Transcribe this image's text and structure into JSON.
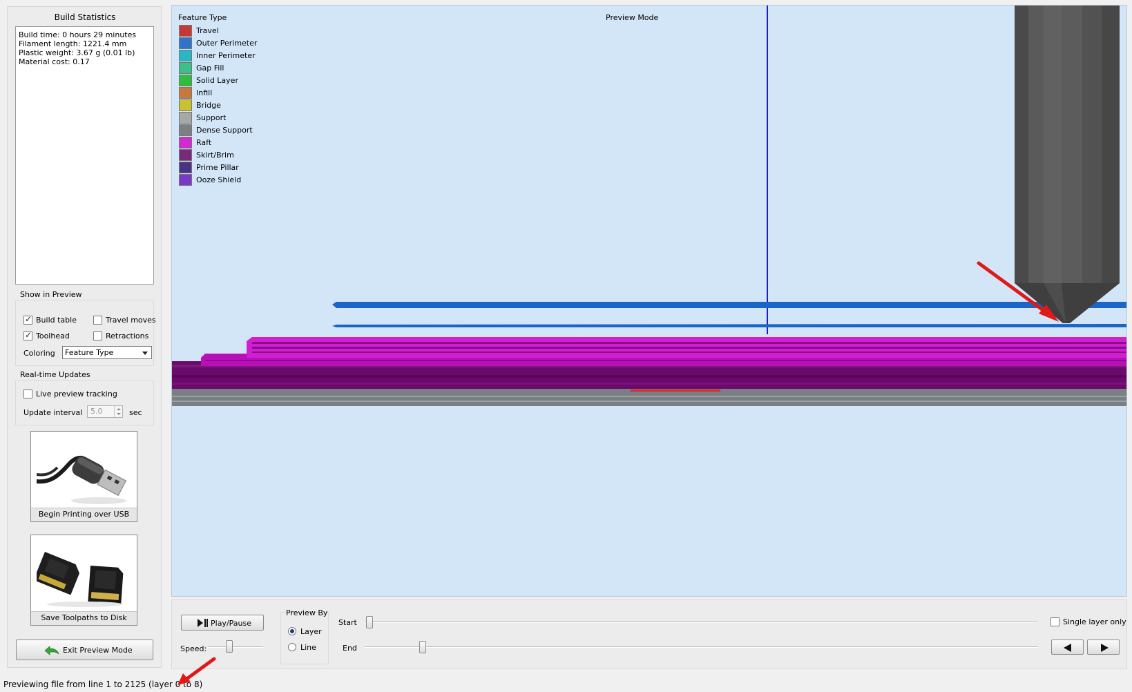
{
  "build_statistics": {
    "title": "Build Statistics",
    "lines": [
      "Build time: 0 hours 29 minutes",
      "Filament length: 1221.4 mm",
      "Plastic weight: 3.67 g (0.01 lb)",
      "Material cost: 0.17"
    ]
  },
  "show_in_preview": {
    "title": "Show in Preview",
    "build_table": {
      "label": "Build table",
      "checked": true
    },
    "travel_moves": {
      "label": "Travel moves",
      "checked": false
    },
    "toolhead": {
      "label": "Toolhead",
      "checked": true
    },
    "retractions": {
      "label": "Retractions",
      "checked": false
    },
    "coloring_label": "Coloring",
    "coloring_value": "Feature Type"
  },
  "realtime_updates": {
    "title": "Real-time Updates",
    "live_preview": {
      "label": "Live preview tracking",
      "checked": false
    },
    "interval_label": "Update interval",
    "interval_value": "5.0",
    "interval_unit": "sec"
  },
  "actions": {
    "usb_label": "Begin Printing over USB",
    "save_label": "Save Toolpaths to Disk",
    "exit_label": "Exit Preview Mode"
  },
  "viewport": {
    "legend_title": "Feature Type",
    "mode_label": "Preview Mode",
    "legend": [
      {
        "label": "Travel",
        "color": "#c83737"
      },
      {
        "label": "Outer Perimeter",
        "color": "#2f74c9"
      },
      {
        "label": "Inner Perimeter",
        "color": "#26b8c4"
      },
      {
        "label": "Gap Fill",
        "color": "#3cc08a"
      },
      {
        "label": "Solid Layer",
        "color": "#2fbd3c"
      },
      {
        "label": "Infill",
        "color": "#c8783a"
      },
      {
        "label": "Bridge",
        "color": "#c8c232"
      },
      {
        "label": "Support",
        "color": "#a8a8a8"
      },
      {
        "label": "Dense Support",
        "color": "#7c7f83"
      },
      {
        "label": "Raft",
        "color": "#d02ad0"
      },
      {
        "label": "Skirt/Brim",
        "color": "#7a2a7a"
      },
      {
        "label": "Prime Pillar",
        "color": "#4a3285"
      },
      {
        "label": "Ooze Shield",
        "color": "#7a38c8"
      }
    ]
  },
  "playback": {
    "play_label": "Play/Pause",
    "speed_label": "Speed:",
    "preview_by_title": "Preview By",
    "layer_label": "Layer",
    "line_label": "Line",
    "preview_by_selected": "Layer",
    "start_label": "Start",
    "end_label": "End",
    "single_layer": {
      "label": "Single layer only",
      "checked": false
    }
  },
  "status_text": "Previewing file from line 1 to 2125 (layer 0 to 8)"
}
